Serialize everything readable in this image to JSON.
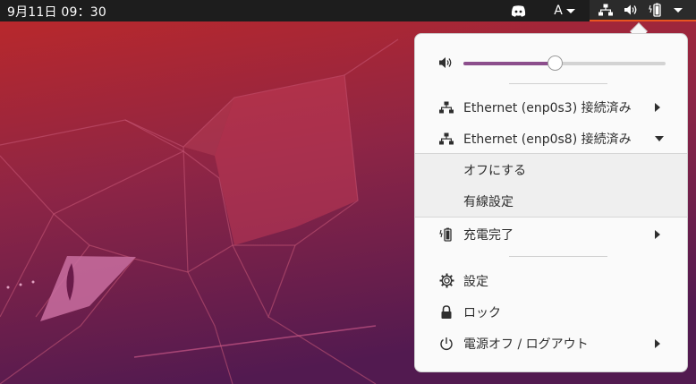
{
  "topbar": {
    "clock": "9月11日  09：30",
    "input_method": "A",
    "accent_color": "#e95420",
    "icons": [
      "discord-icon",
      "network-wired-icon",
      "speaker-volume-icon",
      "battery-charged-icon"
    ]
  },
  "menu": {
    "volume": {
      "icon": "speaker-volume-icon",
      "level": 0.45
    },
    "ethernet1": {
      "label": "Ethernet (enp0s3) 接続済み",
      "icon": "network-wired-icon"
    },
    "ethernet2": {
      "label": "Ethernet (enp0s8) 接続済み",
      "icon": "network-wired-icon",
      "expanded": true
    },
    "ethernet2_submenu": {
      "off": "オフにする",
      "wired_settings": "有線設定"
    },
    "battery": {
      "label": "充電完了",
      "icon": "battery-charged-icon"
    },
    "settings": {
      "label": "設定",
      "icon": "gear-icon"
    },
    "lock": {
      "label": "ロック",
      "icon": "lock-icon"
    },
    "power": {
      "label": "電源オフ / ログアウト",
      "icon": "power-icon"
    }
  },
  "colors": {
    "slider_fill": "#8c4e8c",
    "panel_bg": "#fafafa",
    "wallpaper_top": "#b3282b",
    "wallpaper_bottom": "#5a1a52"
  }
}
